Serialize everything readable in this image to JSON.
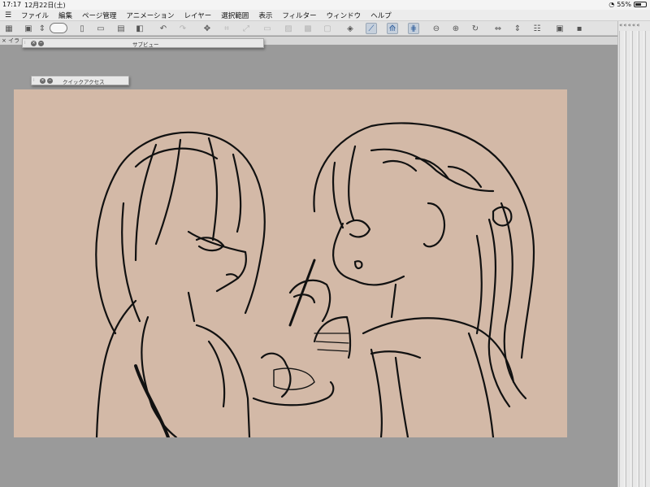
{
  "status": {
    "time": "17:17",
    "date": "12月22日(土)",
    "battery": "55%",
    "battery_level": 0.55
  },
  "menu": {
    "items": [
      "ファイル",
      "編集",
      "ページ管理",
      "アニメーション",
      "レイヤー",
      "選択範囲",
      "表示",
      "フィルター",
      "ウィンドウ",
      "ヘルプ"
    ]
  },
  "toolbar": {
    "icons": [
      "grid-icon",
      "window-icon",
      "spin-arrows-icon",
      "lasso-icon",
      "new-file-icon",
      "open-file-icon",
      "save-icon",
      "page-icon",
      "undo-icon",
      "redo-icon",
      "selection-transform-icon",
      "crop-icon",
      "fit-icon",
      "clear-icon",
      "fill-icon",
      "tone-icon",
      "color-icon",
      "snap-ruler-icon",
      "snap-special-ruler-icon",
      "snap-grid-icon",
      "rotate-reset-icon",
      "zoom-icon",
      "rotate-icon",
      "flip-h-icon",
      "flip-v-icon",
      "view-list-icon",
      "fit-window-icon",
      "panel-icon"
    ]
  },
  "tabs": {
    "document_tab": "× イラ"
  },
  "panels": {
    "subview_title": "サブビュー",
    "quick_access_title": "クイックアクセス"
  },
  "colors": {
    "canvas": "#d3b9a7",
    "workspace": "#9a9a9a",
    "line": "#111111"
  }
}
